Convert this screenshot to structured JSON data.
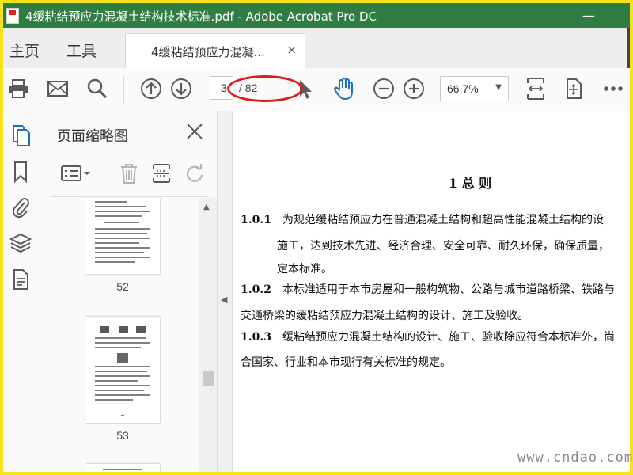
{
  "window": {
    "title": "4缓粘结预应力混凝土结构技术标准.pdf - Adobe Acrobat Pro DC",
    "minimize_glyph": "—"
  },
  "tabs": {
    "home": "主页",
    "tools": "工具",
    "document_tab": "4缓粘结预应力混凝...",
    "close_glyph": "×"
  },
  "toolbar": {
    "icons": [
      "print-icon",
      "email-icon",
      "search-icon",
      "page-up-icon",
      "page-down-icon",
      "select-cursor-icon",
      "hand-icon",
      "zoom-out-icon",
      "zoom-in-icon",
      "fit-page-icon",
      "rotate-page-icon",
      "more-icon"
    ],
    "current_page": "3",
    "page_total": "/ 82",
    "zoom": "66.7%"
  },
  "rail": {
    "icons": [
      "page-thumbnails-icon",
      "bookmark-icon",
      "attachment-icon",
      "layers-icon",
      "content-icon"
    ]
  },
  "thumbnails_panel": {
    "title": "页面缩略图",
    "tools": [
      "options-menu-icon",
      "delete-icon",
      "extract-icon",
      "rotate-icon"
    ],
    "pages": [
      {
        "label": "52"
      },
      {
        "label": "53"
      }
    ]
  },
  "document": {
    "heading": "1  总  则",
    "paragraphs": [
      {
        "number": "1.0.1",
        "lines": [
          "为规范缓粘结预应力在普通混凝土结构和超高性能混凝土结构的设",
          "施工，达到技术先进、经济合理、安全可靠、耐久环保，确保质量，",
          "定本标准。"
        ]
      },
      {
        "number": "1.0.2",
        "lines": [
          "本标准适用于本市房屋和一般构筑物、公路与城市道路桥梁、铁路与",
          "交通桥梁的缓粘结预应力混凝土结构的设计、施工及验收。"
        ]
      },
      {
        "number": "1.0.3",
        "lines": [
          "缓粘结预应力混凝土结构的设计、施工、验收除应符合本标准外，尚",
          "合国家、行业和本市现行有关标准的规定。"
        ]
      }
    ]
  },
  "watermark": "www.cndao.com",
  "colors": {
    "title_bar": "#2f7d43",
    "frame": "#f7e21b",
    "annotation": "#d81e1e",
    "icon": "#5a5a5a",
    "accent_blue": "#1f6fc6"
  }
}
